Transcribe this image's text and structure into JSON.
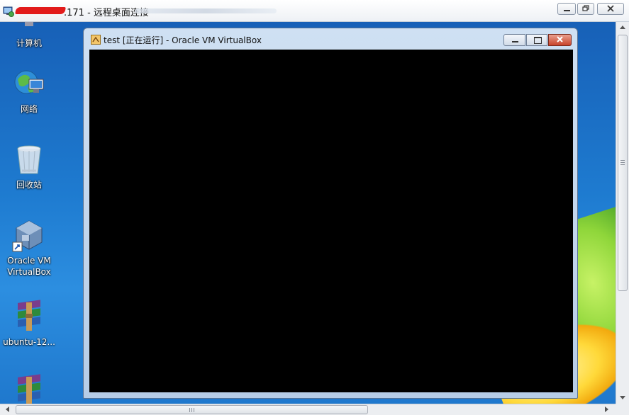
{
  "rdp_window": {
    "title_suffix": ".171 - 远程桌面连接"
  },
  "desktop": {
    "icons": [
      {
        "label": "计算机"
      },
      {
        "label": "网络"
      },
      {
        "label": "回收站"
      },
      {
        "label": "Oracle VM\nVirtualBox"
      },
      {
        "label": "ubuntu-12..."
      },
      {
        "label": ""
      }
    ]
  },
  "vbox_window": {
    "title": "test [正在运行] - Oracle VM VirtualBox"
  },
  "colors": {
    "desktop_blue": "#1e7bd0",
    "vm_screen": "#000000",
    "close_red": "#d9442f"
  }
}
